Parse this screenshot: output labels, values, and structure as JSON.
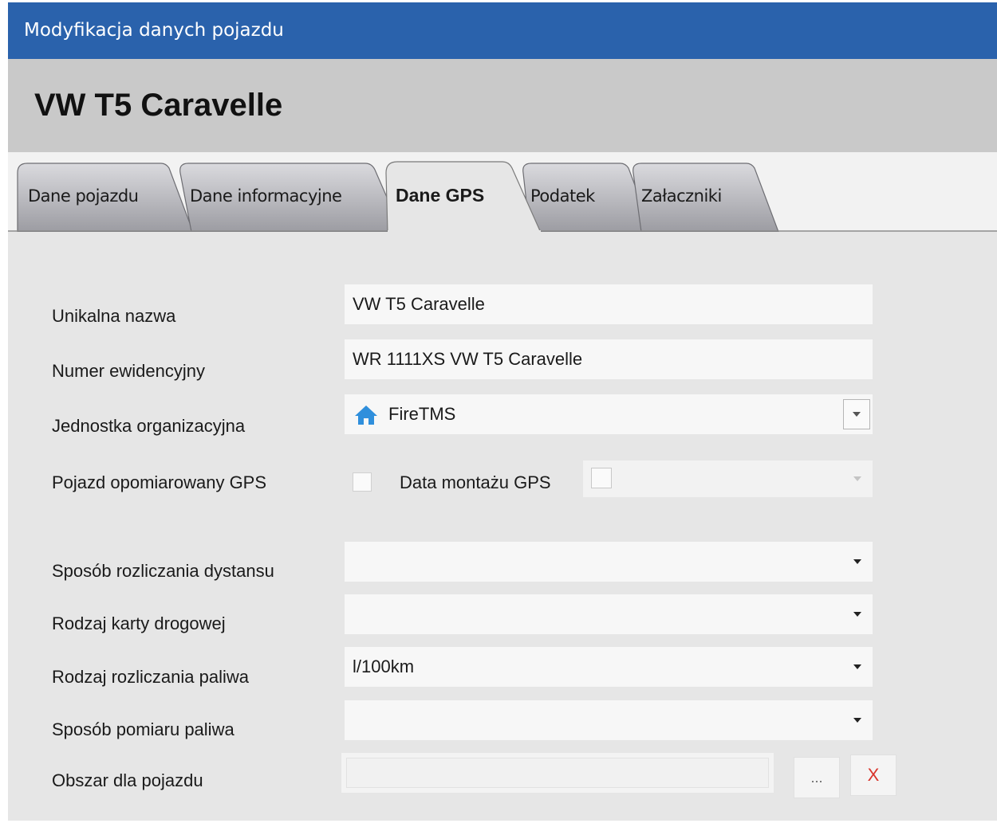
{
  "window": {
    "title": "Modyfikacja danych pojazdu"
  },
  "header": {
    "vehicle_name": "VW T5 Caravelle"
  },
  "tabs": [
    {
      "label": "Dane pojazdu",
      "active": false
    },
    {
      "label": "Dane informacyjne",
      "active": false
    },
    {
      "label": "Dane GPS",
      "active": true
    },
    {
      "label": "Podatek",
      "active": false
    },
    {
      "label": "Załaczniki",
      "active": false
    }
  ],
  "form": {
    "unique_name": {
      "label": "Unikalna nazwa",
      "value": "VW T5 Caravelle"
    },
    "registration_number": {
      "label": "Numer ewidencyjny",
      "value": "WR 1111XS VW T5 Caravelle"
    },
    "org_unit": {
      "label": "Jednostka organizacyjna",
      "value": "FireTMS",
      "icon": "home-icon"
    },
    "gps_metered": {
      "label": "Pojazd opomiarowany GPS",
      "checked": false
    },
    "gps_install_date": {
      "label": "Data montażu GPS",
      "value": "",
      "checked": false,
      "enabled": false
    },
    "distance_settlement": {
      "label": "Sposób rozliczania dystansu",
      "value": ""
    },
    "route_card_type": {
      "label": "Rodzaj karty drogowej",
      "value": ""
    },
    "fuel_settlement_type": {
      "label": "Rodzaj rozliczania paliwa",
      "value": "l/100km"
    },
    "fuel_measurement": {
      "label": "Sposób pomiaru paliwa",
      "value": ""
    },
    "vehicle_area": {
      "label": "Obszar dla pojazdu",
      "value": "",
      "browse_label": "...",
      "clear_label": "X"
    }
  },
  "colors": {
    "titlebar": "#2a62ac",
    "header": "#c9c9c9",
    "content": "#e6e6e6",
    "clear_red": "#d9342b",
    "home_icon": "#2f8fdc"
  }
}
